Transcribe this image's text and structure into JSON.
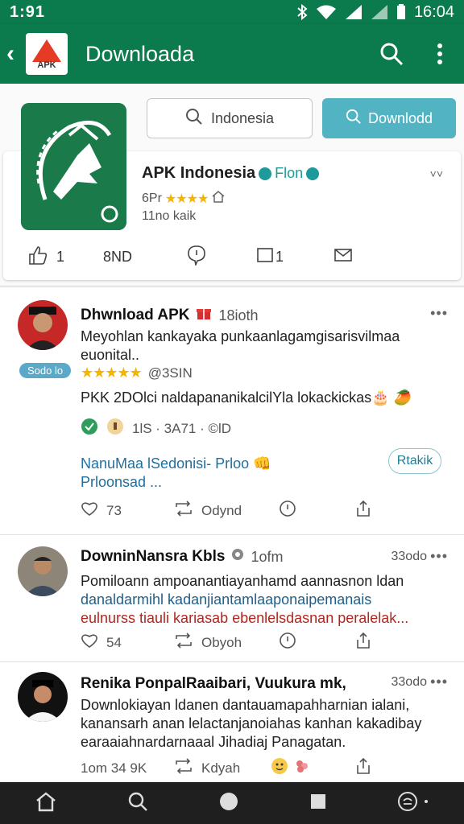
{
  "status_bar": {
    "time_left": "1:91",
    "time_right": "16:04"
  },
  "app_bar": {
    "title": "Downloada",
    "logo_text": "APK",
    "icons": [
      "back-icon",
      "search-icon",
      "more-vert-icon"
    ]
  },
  "header": {
    "search_label": "Indonesia",
    "download_label": "Downlodd",
    "app_name": "APK Indonesia",
    "verified_label": "Flon",
    "rating_prefix": "6Pr",
    "stars": "★★★★",
    "sub_text": "11no kaik",
    "actions": {
      "like_count": "1",
      "second": "8ND",
      "comment": "",
      "share_count": "1"
    },
    "colors": {
      "primary": "#0b7a4c",
      "accent": "#52b4c2",
      "star": "#f4b400"
    }
  },
  "posts": [
    {
      "name": "Dhwnload APK",
      "meta": "18ioth",
      "chip": "Sodo lo",
      "text": "Meyohlan kankayaka punkaanlagamgisarisvilmaa euonital..",
      "stars": "★★★★★",
      "rating_text": "@3SIN",
      "line2": "PKK 2DOlci naldapananikalcilYla lokackickas🎂 🥭",
      "meta_row": "1lS · 3A71 · ©lD",
      "link1": "NanuMaa lSedonisi- Prloo 👊",
      "link2": "Prloonsad ...",
      "follow": "Rtakik",
      "foot": {
        "likes": "73",
        "repost": "Odynd"
      }
    },
    {
      "name": "DowninNansra Kbls",
      "meta": "1ofm",
      "time": "33odo",
      "text1": "Pomiloann ampoanantiayanhamd aannasnon ldan",
      "text2": "danaldarmihl kadanjiantamlaaponaipemanais",
      "text3": "eulnurss tiauli kariasab ebenlelsdasnan peralelak...",
      "foot": {
        "likes": "54",
        "repost": "Obyoh"
      }
    },
    {
      "name": "Renika PonpalRaaibari, Vuukura mk,",
      "time": "33odo",
      "text": "Downlokiayan ldanen dantauamapahharnian ialani, kanansarh anan lelactanjanoiahas kanhan kakadibay earaaiahnardarnaaal Jihadiaj Panagatan.",
      "foot": {
        "likes": "1om 34 9K",
        "repost": "Kdyah"
      }
    }
  ],
  "nav_bar": {
    "icons": [
      "home-icon",
      "search-icon",
      "circle-icon",
      "square-icon",
      "account-icon"
    ]
  }
}
